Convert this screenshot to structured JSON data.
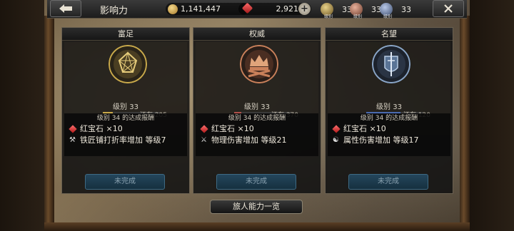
{
  "header": {
    "title": "影响力",
    "gold": "1,141,447",
    "rubies": "2,921",
    "plus": "+",
    "badges": [
      {
        "label": "级别",
        "value": "33"
      },
      {
        "label": "级别",
        "value": "33"
      },
      {
        "label": "级别",
        "value": "33"
      }
    ]
  },
  "panels": [
    {
      "name": "富足",
      "level": "级别  33",
      "remain": "还有 205",
      "progress": 0.18,
      "reward_title": "级别  34  的达成报酬",
      "rewards": [
        {
          "icon": "ruby-icon",
          "text": "红宝石  ×10"
        },
        {
          "icon": "hammer-icon",
          "text": "铁匠铺打折率增加  等级7"
        }
      ],
      "status": "未完成",
      "emblem_color": "#c9a94a"
    },
    {
      "name": "权威",
      "level": "级别  33",
      "remain": "还有 370",
      "progress": 0.12,
      "reward_title": "级别  34  的达成报酬",
      "rewards": [
        {
          "icon": "ruby-icon",
          "text": "红宝石  ×10"
        },
        {
          "icon": "attack-icon",
          "text": "物理伤害增加  等级21"
        }
      ],
      "status": "未完成",
      "emblem_color": "#c9805a"
    },
    {
      "name": "名望",
      "level": "级别  33",
      "remain": "还有 120",
      "progress": 0.6,
      "reward_title": "级别  34  的达成报酬",
      "rewards": [
        {
          "icon": "ruby-icon",
          "text": "红宝石  ×10"
        },
        {
          "icon": "element-icon",
          "text": "属性伤害增加  等级17"
        }
      ],
      "status": "未完成",
      "emblem_color": "#8aa6c8"
    }
  ],
  "footer": {
    "traveler_abilities": "旅人能力一览"
  },
  "colors": {
    "bar_gold": "#c9a94a",
    "bar_red": "#b0504a",
    "bar_blue": "#4a6ab0"
  }
}
